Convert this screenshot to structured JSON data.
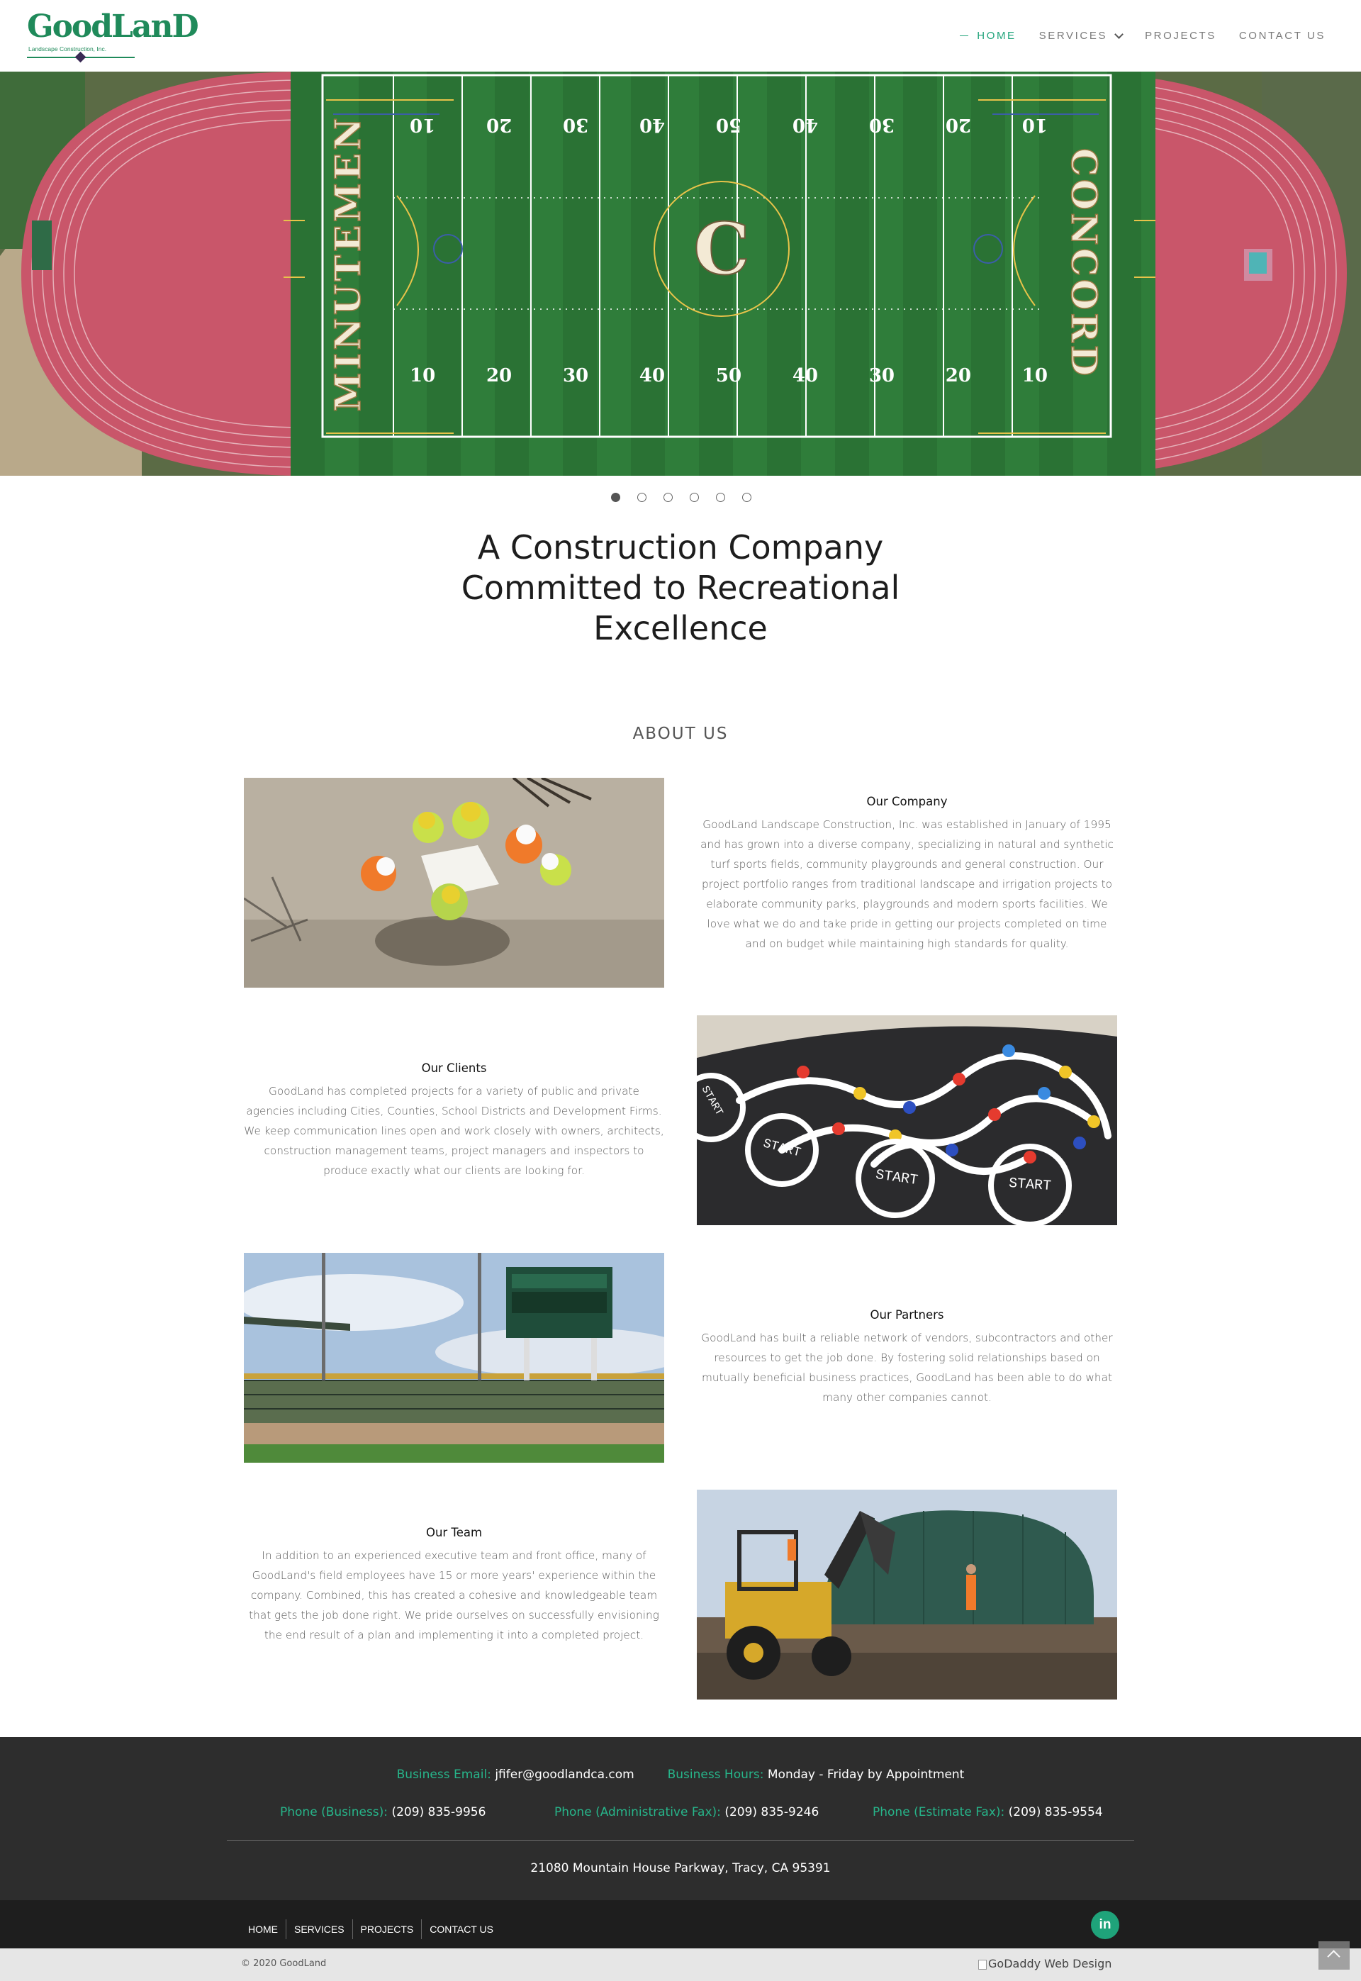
{
  "header": {
    "logo_word": "GoodLanD",
    "logo_sub": "Landscape Construction, Inc.",
    "nav": [
      {
        "label": "HOME"
      },
      {
        "label": "SERVICES"
      },
      {
        "label": "PROJECTS"
      },
      {
        "label": "CONTACT US"
      }
    ]
  },
  "hero": {
    "field_text_left": "MINUTEMEN",
    "field_text_right": "CONCORD",
    "field_logo": "C",
    "yard_top": [
      "10",
      "20",
      "30",
      "40",
      "50",
      "40",
      "30",
      "20",
      "10"
    ],
    "yard_bottom": [
      "10",
      "20",
      "30",
      "40",
      "50",
      "40",
      "30",
      "20",
      "10"
    ],
    "slide_count": 6,
    "active_slide": 1
  },
  "headline": {
    "line1": "A Construction Company",
    "line2": "Committed to Recreational",
    "line3": "Excellence"
  },
  "about": {
    "title": "ABOUT US",
    "company": {
      "title": "Our Company",
      "body": "GoodLand Landscape Construction, Inc. was established in January of 1995 and has grown into a diverse company, specializing in natural and synthetic turf sports fields, community playgrounds and general construction. Our project portfolio ranges from traditional landscape and irrigation projects to elaborate community parks, playgrounds and modern sports facilities. We love what we do and take pride in getting our projects completed on time and on budget while maintaining high standards for quality."
    },
    "clients": {
      "title": "Our Clients",
      "body": "GoodLand has completed projects for a variety of public and private agencies including Cities, Counties, School Districts and Development Firms. We keep communication lines open and work closely with owners, architects, construction management teams, project managers and inspectors to produce exactly what our clients are looking for."
    },
    "partners": {
      "title": "Our Partners",
      "body": "GoodLand has built a reliable network of vendors, subcontractors and other resources to get the job done. By fostering solid relationships based on mutually beneficial business practices, GoodLand has been able to do what many other companies cannot."
    },
    "team": {
      "title": "Our Team",
      "body": "In addition to an experienced executive team and front office, many of GoodLand's field employees have 15 or more years' experience within the company. Combined, this has created a cohesive and knowledgeable team that gets the job done right. We pride ourselves on successfully envisioning the end result of a plan and implementing it into a completed project."
    },
    "playground_labels": [
      "START",
      "START",
      "START",
      "START"
    ]
  },
  "footer": {
    "email_label": "Business Email:",
    "email_value": "jfifer@goodlandca.com",
    "hours_label": "Business Hours:",
    "hours_value": "Monday - Friday by Appointment",
    "phone_business_label": "Phone (Business):",
    "phone_business_value": "(209) 835-9956",
    "phone_admin_label": "Phone (Administrative Fax):",
    "phone_admin_value": "(209) 835-9246",
    "phone_estimate_label": "Phone (Estimate Fax):",
    "phone_estimate_value": "(209) 835-9554",
    "address": "21080 Mountain House Parkway, Tracy, CA 95391",
    "bottom_nav": [
      "HOME",
      "SERVICES",
      "PROJECTS",
      "CONTACT US"
    ],
    "linkedin_glyph": "in",
    "copyright": "© 2020 GoodLand",
    "godaddy": "GoDaddy Web Design"
  },
  "colors": {
    "accent": "#1fa37a",
    "footer_bg": "#2d2d2d",
    "track": "#c9566a",
    "turf": "#2f7d3a"
  },
  "icons": [
    "chevron-down-icon",
    "linkedin-icon",
    "scroll-top-icon",
    "broken-image-icon"
  ]
}
